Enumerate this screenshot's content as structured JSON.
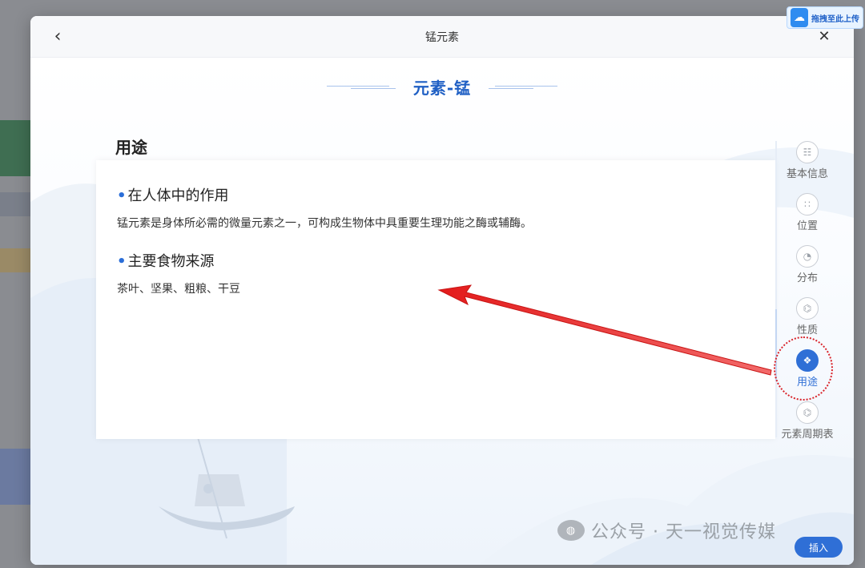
{
  "upload_chip": {
    "logo": "cloud-upload-icon",
    "label": "拖拽至此上传"
  },
  "header": {
    "title": "锰元素",
    "back_icon": "chevron-left-icon",
    "close_icon": "close-icon"
  },
  "element_title": "元素-锰",
  "section_title": "用途",
  "content": [
    {
      "heading": "在人体中的作用",
      "text": "锰元素是身体所必需的微量元素之一，可构成生物体中具重要生理功能之酶或辅酶。"
    },
    {
      "heading": "主要食物来源",
      "text": "茶叶、坚果、粗粮、干豆"
    }
  ],
  "side_nav": {
    "active": "用途",
    "items": [
      {
        "label": "基本信息",
        "icon": "info-list-icon"
      },
      {
        "label": "位置",
        "icon": "grid-circles-icon"
      },
      {
        "label": "分布",
        "icon": "pie-chart-icon"
      },
      {
        "label": "性质",
        "icon": "molecule-icon"
      },
      {
        "label": "用途",
        "icon": "usage-icon"
      },
      {
        "label": "元素周期表",
        "icon": "periodic-table-icon"
      }
    ]
  },
  "watermark": {
    "icon": "wechat-icon",
    "text": "公众号 · 天一视觉传媒"
  },
  "insert_button": "插入",
  "colors": {
    "accent": "#2f6fd6",
    "annotation": "#d9232a"
  }
}
